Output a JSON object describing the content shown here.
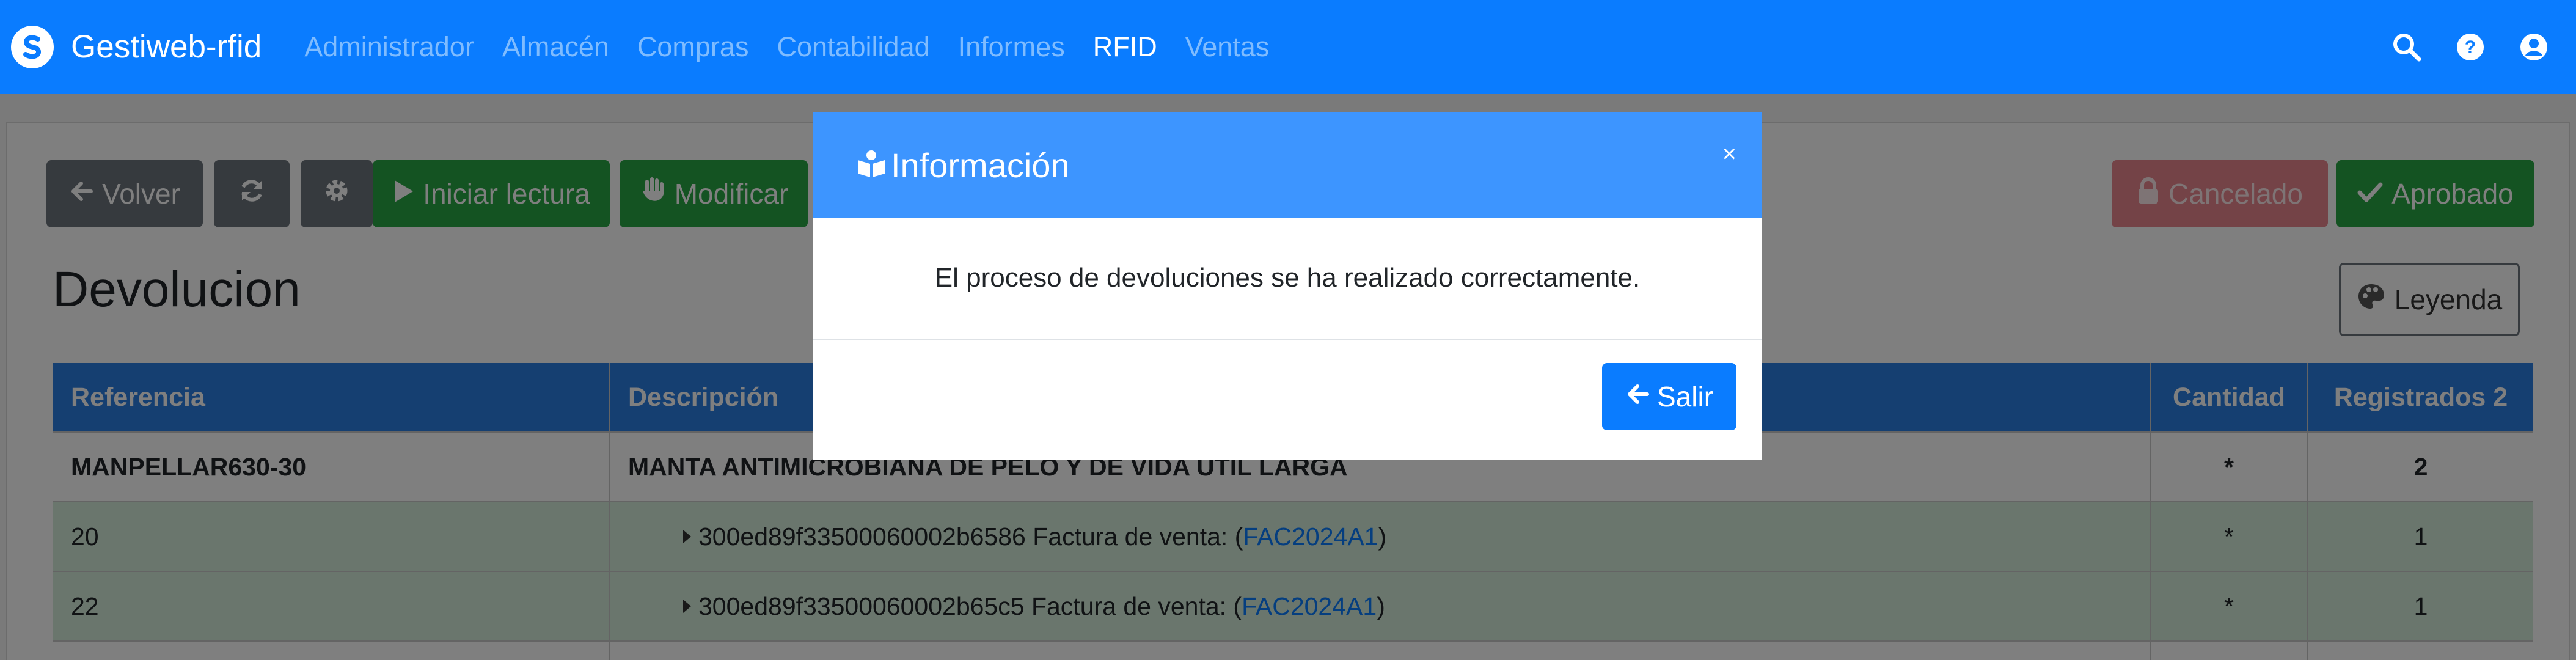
{
  "navbar": {
    "brand": "Gestiweb-rfid",
    "menu": [
      "Administrador",
      "Almacén",
      "Compras",
      "Contabilidad",
      "Informes",
      "RFID",
      "Ventas"
    ],
    "active_menu": "RFID"
  },
  "toolbar": {
    "back_label": "Volver",
    "start_reading_label": "Iniciar lectura",
    "modify_label": "Modificar",
    "cancelled_label": "Cancelado",
    "approved_label": "Aprobado",
    "legend_label": "Leyenda"
  },
  "page": {
    "title": "Devolucion"
  },
  "table": {
    "headers": {
      "reference": "Referencia",
      "description": "Descripción",
      "quantity": "Cantidad",
      "registered": "Registrados 2"
    },
    "parent": {
      "reference": "MANPELLAR630-30",
      "description": "MANTA ANTIMICROBIANA DE PELO Y DE VIDA UTIL LARGA",
      "quantity": "*",
      "registered": "2"
    },
    "rows": [
      {
        "reference": "20",
        "tag": "300ed89f33500060002b6586",
        "invoice_text": "Factura de venta: (",
        "invoice_link": "FAC2024A1",
        "invoice_close": ")",
        "quantity": "*",
        "registered": "1"
      },
      {
        "reference": "22",
        "tag": "300ed89f33500060002b65c5",
        "invoice_text": "Factura de venta: (",
        "invoice_link": "FAC2024A1",
        "invoice_close": ")",
        "quantity": "*",
        "registered": "1"
      }
    ]
  },
  "modal": {
    "title": "Información",
    "close": "×",
    "message": "El proceso de devoluciones se ha realizado correctamente.",
    "exit_label": "Salir"
  },
  "colors": {
    "primary": "#0a7cff",
    "success": "#28a745",
    "row_highlight": "#d4edda",
    "modal_header": "#3d95ff"
  }
}
